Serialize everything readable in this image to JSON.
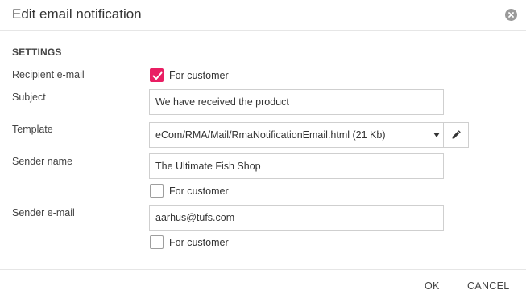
{
  "dialog": {
    "title": "Edit email notification"
  },
  "settings": {
    "section_title": "SETTINGS",
    "recipient": {
      "label": "Recipient e-mail",
      "checkbox_label": "For customer",
      "checked": true
    },
    "subject": {
      "label": "Subject",
      "value": "We have received the product"
    },
    "template": {
      "label": "Template",
      "selected": "eCom/RMA/Mail/RmaNotificationEmail.html (21 Kb)"
    },
    "sender_name": {
      "label": "Sender name",
      "value": "The Ultimate Fish Shop",
      "checkbox_label": "For customer",
      "checked": false
    },
    "sender_email": {
      "label": "Sender e-mail",
      "value": "aarhus@tufs.com",
      "checkbox_label": "For customer",
      "checked": false
    }
  },
  "footer": {
    "ok_label": "OK",
    "cancel_label": "CANCEL"
  },
  "colors": {
    "accent": "#e91e63",
    "border": "#cfcfcf",
    "divider": "#e6e6e6"
  },
  "icons": {
    "close": "close-circle-icon",
    "check": "checkmark-icon",
    "dropdown": "caret-down-icon",
    "edit": "pencil-icon"
  }
}
